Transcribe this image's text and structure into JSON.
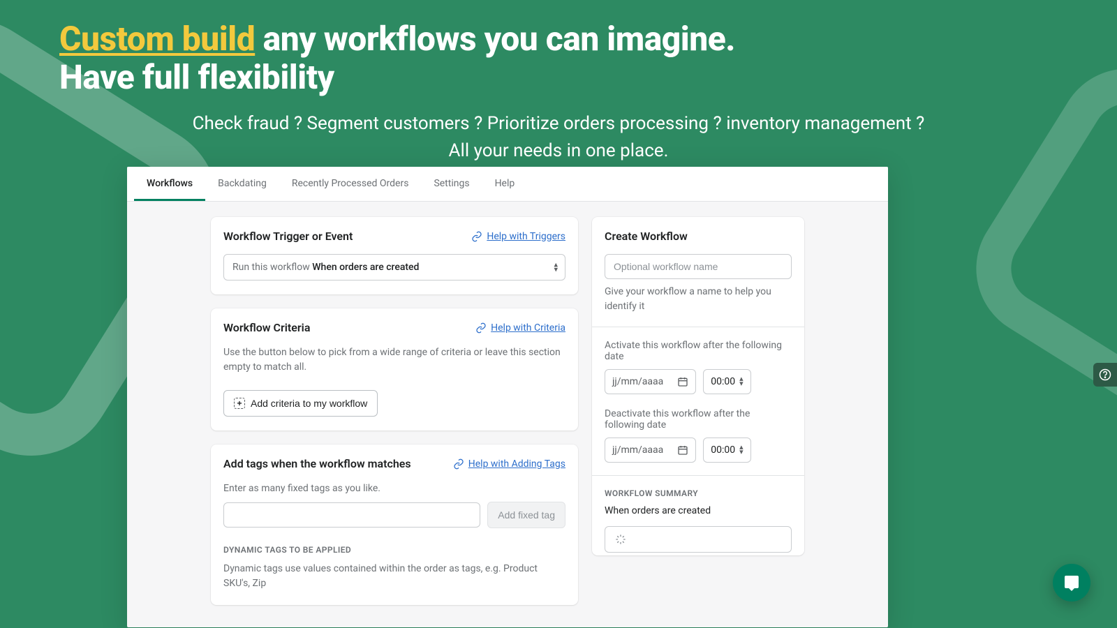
{
  "hero": {
    "accent": "Custom build",
    "rest1": " any workflows you can imagine.",
    "line2": "Have full flexibility",
    "sub1": "Check fraud ? Segment customers ?  Prioritize orders processing ? inventory management ?",
    "sub2": "All your needs in one place."
  },
  "tabs": [
    "Workflows",
    "Backdating",
    "Recently Processed Orders",
    "Settings",
    "Help"
  ],
  "activeTab": 0,
  "trigger": {
    "title": "Workflow Trigger or Event",
    "helpLabel": "Help with Triggers",
    "prefix": "Run this workflow ",
    "value": "When orders are created"
  },
  "criteria": {
    "title": "Workflow Criteria",
    "helpLabel": "Help with Criteria",
    "desc": "Use the button below to pick from a wide range of criteria or leave this section empty to match all.",
    "addBtn": "Add criteria to my workflow"
  },
  "tags": {
    "title": "Add tags when the workflow matches",
    "helpLabel": "Help with Adding Tags",
    "desc": "Enter as many fixed tags as you like.",
    "addFixedBtn": "Add fixed tag",
    "dynTitle": "DYNAMIC TAGS TO BE APPLIED",
    "dynDesc": "Dynamic tags use values contained within the order as tags, e.g. Product SKU's, Zip"
  },
  "create": {
    "title": "Create Workflow",
    "namePlaceholder": "Optional workflow name",
    "nameHelp": "Give your workflow a name to help you identify it",
    "activateLabel": "Activate this workflow after the following date",
    "deactivateLabel": "Deactivate this workflow after the following date",
    "datePlaceholder": "jj/mm/aaaa",
    "timePlaceholder": "00:00",
    "summaryTitle": "WORKFLOW SUMMARY",
    "summaryText": "When orders are created"
  }
}
